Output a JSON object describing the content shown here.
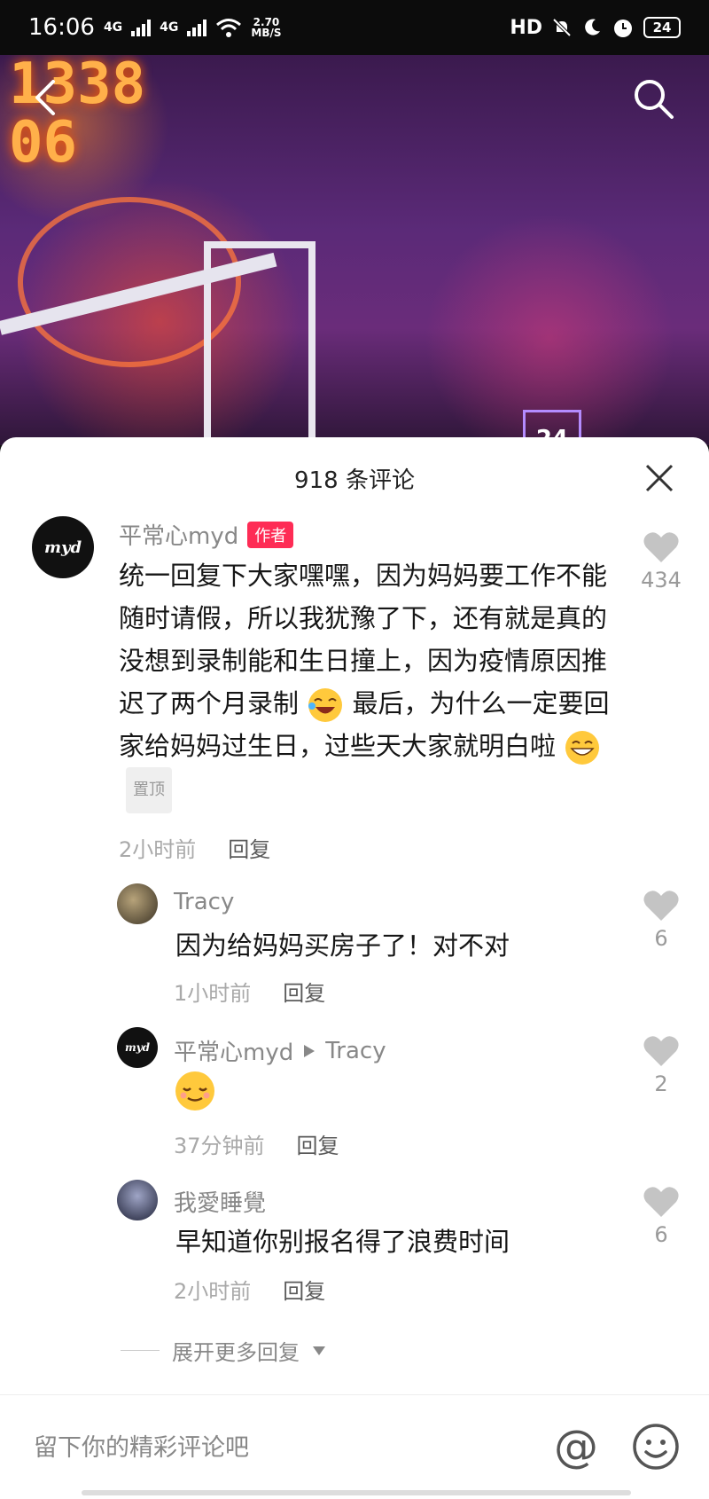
{
  "status_bar": {
    "time": "16:06",
    "net1": "4G",
    "net2": "4G",
    "speed_value": "2.70",
    "speed_unit": "MB/S",
    "hd": "HD",
    "battery": "24"
  },
  "video": {
    "scoreboard": "1338\n06",
    "sign": "24"
  },
  "comments_panel": {
    "title": "918 条评论"
  },
  "comments": [
    {
      "user": "平常心myd",
      "badge": "作者",
      "avatar_text": "myd",
      "text_before_emoji1": "统一回复下大家嘿嘿，因为妈妈要工作不能随时请假，所以我犹豫了下，还有就是真的没想到录制能和生日撞上，因为疫情原因推迟了两个月录制",
      "text_after_emoji1": "最后，为什么一定要回家给妈妈过生日，过些天大家就明白啦",
      "pin_label": "置顶",
      "time": "2小时前",
      "reply_label": "回复",
      "likes": "434"
    }
  ],
  "replies": [
    {
      "user": "Tracy",
      "text": "因为给妈妈买房子了！对不对",
      "time": "1小时前",
      "reply_label": "回复",
      "likes": "6"
    },
    {
      "user": "平常心myd",
      "reply_to": "Tracy",
      "time": "37分钟前",
      "reply_label": "回复",
      "likes": "2",
      "avatar_text": "myd"
    },
    {
      "user": "我愛睡覺",
      "text": "早知道你别报名得了浪费时间",
      "time": "2小时前",
      "reply_label": "回复",
      "likes": "6"
    }
  ],
  "expand_more": "展开更多回复",
  "input": {
    "placeholder": "留下你的精彩评论吧",
    "at_symbol": "@"
  }
}
